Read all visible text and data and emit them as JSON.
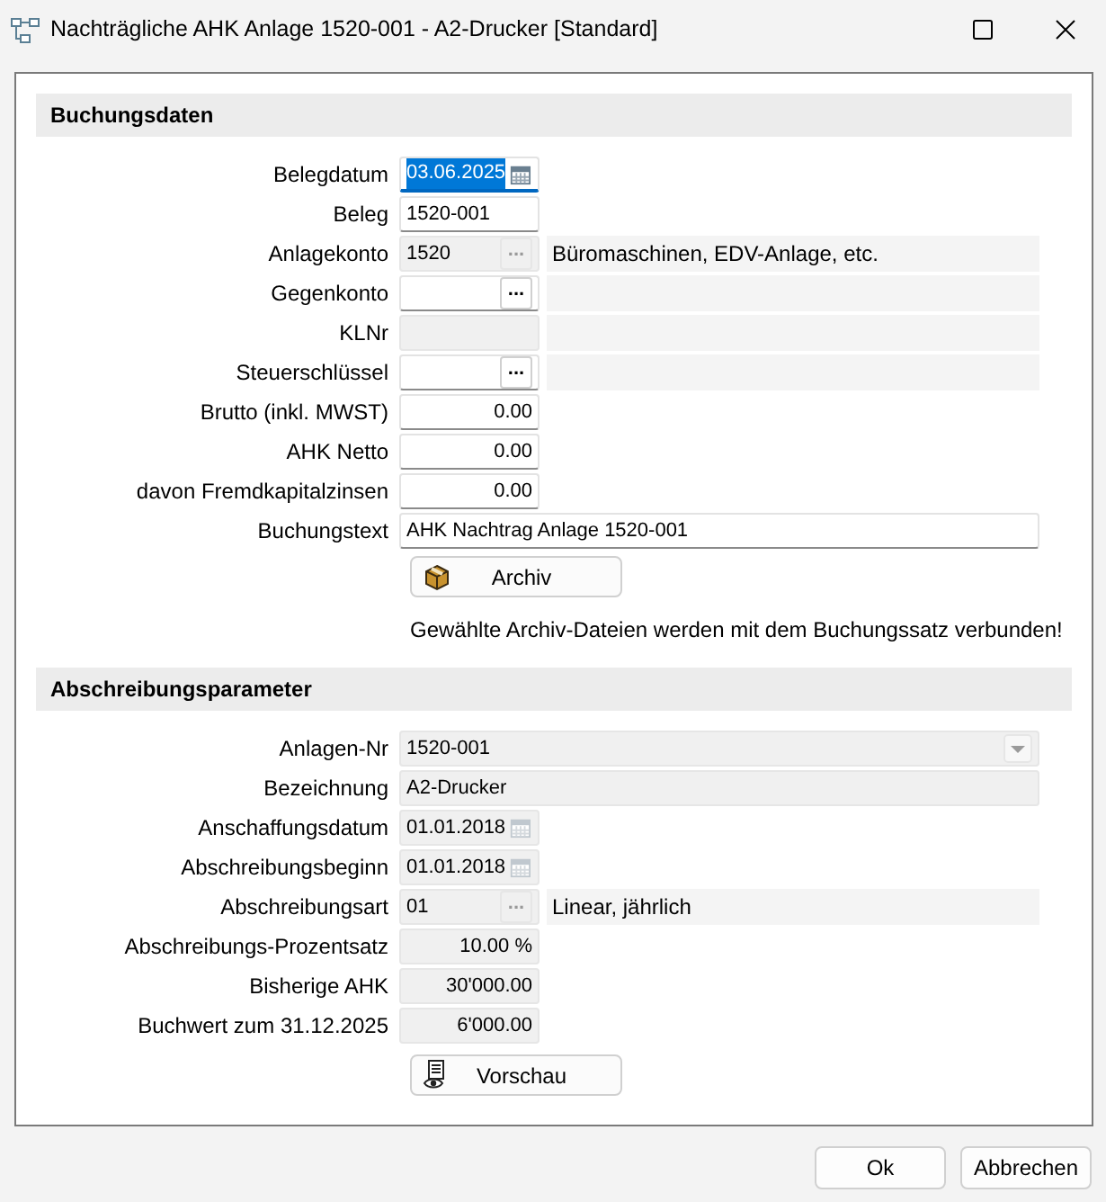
{
  "window": {
    "title": "Nachträgliche AHK Anlage 1520-001 - A2-Drucker [Standard]"
  },
  "sections": [
    {
      "title": "Buchungsdaten",
      "rows": [
        {
          "label": "Belegdatum",
          "kind": "date",
          "value": "03.06.2025",
          "readonly": false,
          "focused": true
        },
        {
          "label": "Beleg",
          "kind": "text",
          "value": "1520-001",
          "readonly": false,
          "focused": false
        },
        {
          "label": "Anlagekonto",
          "kind": "lookup",
          "value": "1520",
          "button": "...",
          "readonly": true,
          "focused": false,
          "panel": true,
          "description": "Büromaschinen, EDV-Anlage, etc."
        },
        {
          "label": "Gegenkonto",
          "kind": "lookup",
          "button": "...",
          "readonly": false,
          "focused": false,
          "panel": true
        },
        {
          "label": "KLNr",
          "kind": "text",
          "readonly": true,
          "focused": false,
          "panel": true
        },
        {
          "label": "Steuerschlüssel",
          "kind": "lookup",
          "button": "...",
          "readonly": false,
          "focused": false,
          "panel": true
        },
        {
          "label": "Brutto (inkl. MWST)",
          "kind": "number",
          "value": "0.00",
          "readonly": false,
          "focused": false
        },
        {
          "label": "AHK Netto",
          "kind": "number",
          "value": "0.00",
          "readonly": false,
          "focused": false
        },
        {
          "label": "davon Fremdkapitalzinsen",
          "kind": "number",
          "value": "0.00",
          "readonly": false,
          "focused": false
        },
        {
          "label": "Buchungstext",
          "kind": "wide",
          "value": "AHK Nachtrag Anlage 1520-001",
          "readonly": false,
          "focused": false
        }
      ],
      "button": {
        "label": "Archiv",
        "kind": "archive"
      },
      "note": "Gewählte Archiv-Dateien werden mit dem Buchungssatz verbunden!"
    },
    {
      "title": "Abschreibungsparameter",
      "rows": [
        {
          "label": "Anlagen-Nr",
          "kind": "combo",
          "value": "1520-001",
          "readonly": true,
          "focused": false
        },
        {
          "label": "Bezeichnung",
          "kind": "wide",
          "value": "A2-Drucker",
          "readonly": true,
          "focused": false
        },
        {
          "label": "Anschaffungsdatum",
          "kind": "date",
          "value": "01.01.2018",
          "readonly": true,
          "focused": false
        },
        {
          "label": "Abschreibungsbeginn",
          "kind": "date",
          "value": "01.01.2018",
          "readonly": true,
          "focused": false
        },
        {
          "label": "Abschreibungsart",
          "kind": "lookup",
          "value": "01",
          "button": "...",
          "readonly": true,
          "focused": false,
          "panel": true,
          "description": "Linear, jährlich"
        },
        {
          "label": "Abschreibungs-Prozentsatz",
          "kind": "number",
          "value": "10.00 %",
          "readonly": true,
          "focused": false
        },
        {
          "label": "Bisherige AHK",
          "kind": "number",
          "value": "30'000.00",
          "readonly": true,
          "focused": false
        },
        {
          "label": "Buchwert zum 31.12.2025",
          "kind": "number",
          "value": "6'000.00",
          "readonly": true,
          "focused": false
        }
      ],
      "button": {
        "label": "Vorschau",
        "kind": "preview"
      }
    }
  ],
  "footer_buttons": [
    "Ok",
    "Abbrechen"
  ]
}
